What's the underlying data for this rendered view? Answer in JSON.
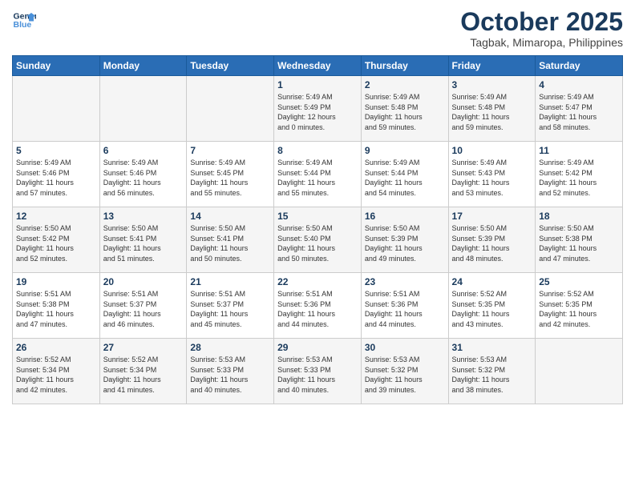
{
  "header": {
    "logo_line1": "General",
    "logo_line2": "Blue",
    "month_title": "October 2025",
    "subtitle": "Tagbak, Mimaropa, Philippines"
  },
  "days_of_week": [
    "Sunday",
    "Monday",
    "Tuesday",
    "Wednesday",
    "Thursday",
    "Friday",
    "Saturday"
  ],
  "weeks": [
    [
      {
        "day": "",
        "info": ""
      },
      {
        "day": "",
        "info": ""
      },
      {
        "day": "",
        "info": ""
      },
      {
        "day": "1",
        "info": "Sunrise: 5:49 AM\nSunset: 5:49 PM\nDaylight: 12 hours\nand 0 minutes."
      },
      {
        "day": "2",
        "info": "Sunrise: 5:49 AM\nSunset: 5:48 PM\nDaylight: 11 hours\nand 59 minutes."
      },
      {
        "day": "3",
        "info": "Sunrise: 5:49 AM\nSunset: 5:48 PM\nDaylight: 11 hours\nand 59 minutes."
      },
      {
        "day": "4",
        "info": "Sunrise: 5:49 AM\nSunset: 5:47 PM\nDaylight: 11 hours\nand 58 minutes."
      }
    ],
    [
      {
        "day": "5",
        "info": "Sunrise: 5:49 AM\nSunset: 5:46 PM\nDaylight: 11 hours\nand 57 minutes."
      },
      {
        "day": "6",
        "info": "Sunrise: 5:49 AM\nSunset: 5:46 PM\nDaylight: 11 hours\nand 56 minutes."
      },
      {
        "day": "7",
        "info": "Sunrise: 5:49 AM\nSunset: 5:45 PM\nDaylight: 11 hours\nand 55 minutes."
      },
      {
        "day": "8",
        "info": "Sunrise: 5:49 AM\nSunset: 5:44 PM\nDaylight: 11 hours\nand 55 minutes."
      },
      {
        "day": "9",
        "info": "Sunrise: 5:49 AM\nSunset: 5:44 PM\nDaylight: 11 hours\nand 54 minutes."
      },
      {
        "day": "10",
        "info": "Sunrise: 5:49 AM\nSunset: 5:43 PM\nDaylight: 11 hours\nand 53 minutes."
      },
      {
        "day": "11",
        "info": "Sunrise: 5:49 AM\nSunset: 5:42 PM\nDaylight: 11 hours\nand 52 minutes."
      }
    ],
    [
      {
        "day": "12",
        "info": "Sunrise: 5:50 AM\nSunset: 5:42 PM\nDaylight: 11 hours\nand 52 minutes."
      },
      {
        "day": "13",
        "info": "Sunrise: 5:50 AM\nSunset: 5:41 PM\nDaylight: 11 hours\nand 51 minutes."
      },
      {
        "day": "14",
        "info": "Sunrise: 5:50 AM\nSunset: 5:41 PM\nDaylight: 11 hours\nand 50 minutes."
      },
      {
        "day": "15",
        "info": "Sunrise: 5:50 AM\nSunset: 5:40 PM\nDaylight: 11 hours\nand 50 minutes."
      },
      {
        "day": "16",
        "info": "Sunrise: 5:50 AM\nSunset: 5:39 PM\nDaylight: 11 hours\nand 49 minutes."
      },
      {
        "day": "17",
        "info": "Sunrise: 5:50 AM\nSunset: 5:39 PM\nDaylight: 11 hours\nand 48 minutes."
      },
      {
        "day": "18",
        "info": "Sunrise: 5:50 AM\nSunset: 5:38 PM\nDaylight: 11 hours\nand 47 minutes."
      }
    ],
    [
      {
        "day": "19",
        "info": "Sunrise: 5:51 AM\nSunset: 5:38 PM\nDaylight: 11 hours\nand 47 minutes."
      },
      {
        "day": "20",
        "info": "Sunrise: 5:51 AM\nSunset: 5:37 PM\nDaylight: 11 hours\nand 46 minutes."
      },
      {
        "day": "21",
        "info": "Sunrise: 5:51 AM\nSunset: 5:37 PM\nDaylight: 11 hours\nand 45 minutes."
      },
      {
        "day": "22",
        "info": "Sunrise: 5:51 AM\nSunset: 5:36 PM\nDaylight: 11 hours\nand 44 minutes."
      },
      {
        "day": "23",
        "info": "Sunrise: 5:51 AM\nSunset: 5:36 PM\nDaylight: 11 hours\nand 44 minutes."
      },
      {
        "day": "24",
        "info": "Sunrise: 5:52 AM\nSunset: 5:35 PM\nDaylight: 11 hours\nand 43 minutes."
      },
      {
        "day": "25",
        "info": "Sunrise: 5:52 AM\nSunset: 5:35 PM\nDaylight: 11 hours\nand 42 minutes."
      }
    ],
    [
      {
        "day": "26",
        "info": "Sunrise: 5:52 AM\nSunset: 5:34 PM\nDaylight: 11 hours\nand 42 minutes."
      },
      {
        "day": "27",
        "info": "Sunrise: 5:52 AM\nSunset: 5:34 PM\nDaylight: 11 hours\nand 41 minutes."
      },
      {
        "day": "28",
        "info": "Sunrise: 5:53 AM\nSunset: 5:33 PM\nDaylight: 11 hours\nand 40 minutes."
      },
      {
        "day": "29",
        "info": "Sunrise: 5:53 AM\nSunset: 5:33 PM\nDaylight: 11 hours\nand 40 minutes."
      },
      {
        "day": "30",
        "info": "Sunrise: 5:53 AM\nSunset: 5:32 PM\nDaylight: 11 hours\nand 39 minutes."
      },
      {
        "day": "31",
        "info": "Sunrise: 5:53 AM\nSunset: 5:32 PM\nDaylight: 11 hours\nand 38 minutes."
      },
      {
        "day": "",
        "info": ""
      }
    ]
  ]
}
